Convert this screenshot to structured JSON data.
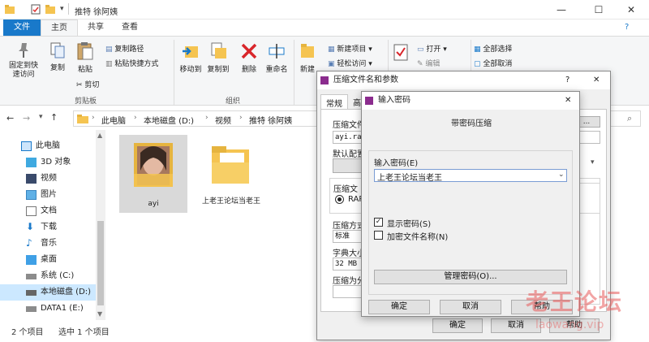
{
  "window": {
    "title": "推特 徐阿姨",
    "min_glyph": "—",
    "max_glyph": "☐",
    "close_glyph": "✕"
  },
  "tabs": [
    "文件",
    "主页",
    "共享",
    "查看"
  ],
  "ribbon": {
    "pin_label": "固定到快速访问",
    "copy_label": "复制",
    "paste_label": "粘贴",
    "copy_path": "复制路径",
    "paste_shortcut": "粘贴快捷方式",
    "cut": "剪切",
    "clipboard_group": "剪贴板",
    "move_to": "移动到",
    "copy_to": "复制到",
    "delete": "删除",
    "rename": "重命名",
    "organize_group": "组织",
    "new_label": "新建",
    "new_item": "新建项目",
    "easy_access": "轻松访问",
    "open": "打开",
    "edit": "编辑",
    "select_all": "全部选择",
    "select_none": "全部取消"
  },
  "address": {
    "crumbs": [
      "此电脑",
      "本地磁盘 (D:)",
      "视频",
      "推特 徐阿姨"
    ],
    "sep": "›"
  },
  "nav": [
    {
      "label": "此电脑",
      "icon": "computer-icon"
    },
    {
      "label": "3D 对象",
      "icon": "cube-icon"
    },
    {
      "label": "视频",
      "icon": "video-icon"
    },
    {
      "label": "图片",
      "icon": "pictures-icon"
    },
    {
      "label": "文档",
      "icon": "documents-icon"
    },
    {
      "label": "下载",
      "icon": "download-icon"
    },
    {
      "label": "音乐",
      "icon": "music-icon"
    },
    {
      "label": "桌面",
      "icon": "desktop-icon"
    },
    {
      "label": "系统 (C:)",
      "icon": "drive-icon"
    },
    {
      "label": "本地磁盘 (D:)",
      "icon": "drive-icon"
    },
    {
      "label": "DATA1 (E:)",
      "icon": "drive-icon"
    }
  ],
  "files": [
    {
      "name": "ayi"
    },
    {
      "name": "上老王论坛当老王"
    }
  ],
  "status": {
    "count": "2 个项目",
    "selected": "选中 1 个项目"
  },
  "rar_dialog": {
    "title": "压缩文件名和参数",
    "tab_general": "常规",
    "tab_second": "高",
    "archive_label": "压缩文件",
    "archive_value": "ayi.rar",
    "default_profile": "默认配置",
    "format_label": "压缩文",
    "format_rar": "RAR",
    "method_label": "压缩方式",
    "method_value": "标准",
    "dict_label": "字典大小",
    "dict_value": "32 MB",
    "split_label": "压缩为分",
    "help_glyph": "?",
    "close_glyph": "✕",
    "ok": "确定",
    "cancel": "取消",
    "help": "帮助"
  },
  "pwd_dialog": {
    "title": "输入密码",
    "heading": "带密码压缩",
    "enter_label": "输入密码(E)",
    "password_value": "上老王论坛当老王",
    "show_password": "显示密码(S)",
    "encrypt_names": "加密文件名称(N)",
    "manage": "管理密码(O)...",
    "ok": "确定",
    "cancel": "取消",
    "help": "帮助",
    "close_glyph": "✕"
  },
  "watermark": {
    "text": "老王论坛",
    "url": "laowang.vip"
  },
  "colors": {
    "accent": "#1979ca",
    "selection": "#cce8ff",
    "folder": "#f5c451"
  }
}
